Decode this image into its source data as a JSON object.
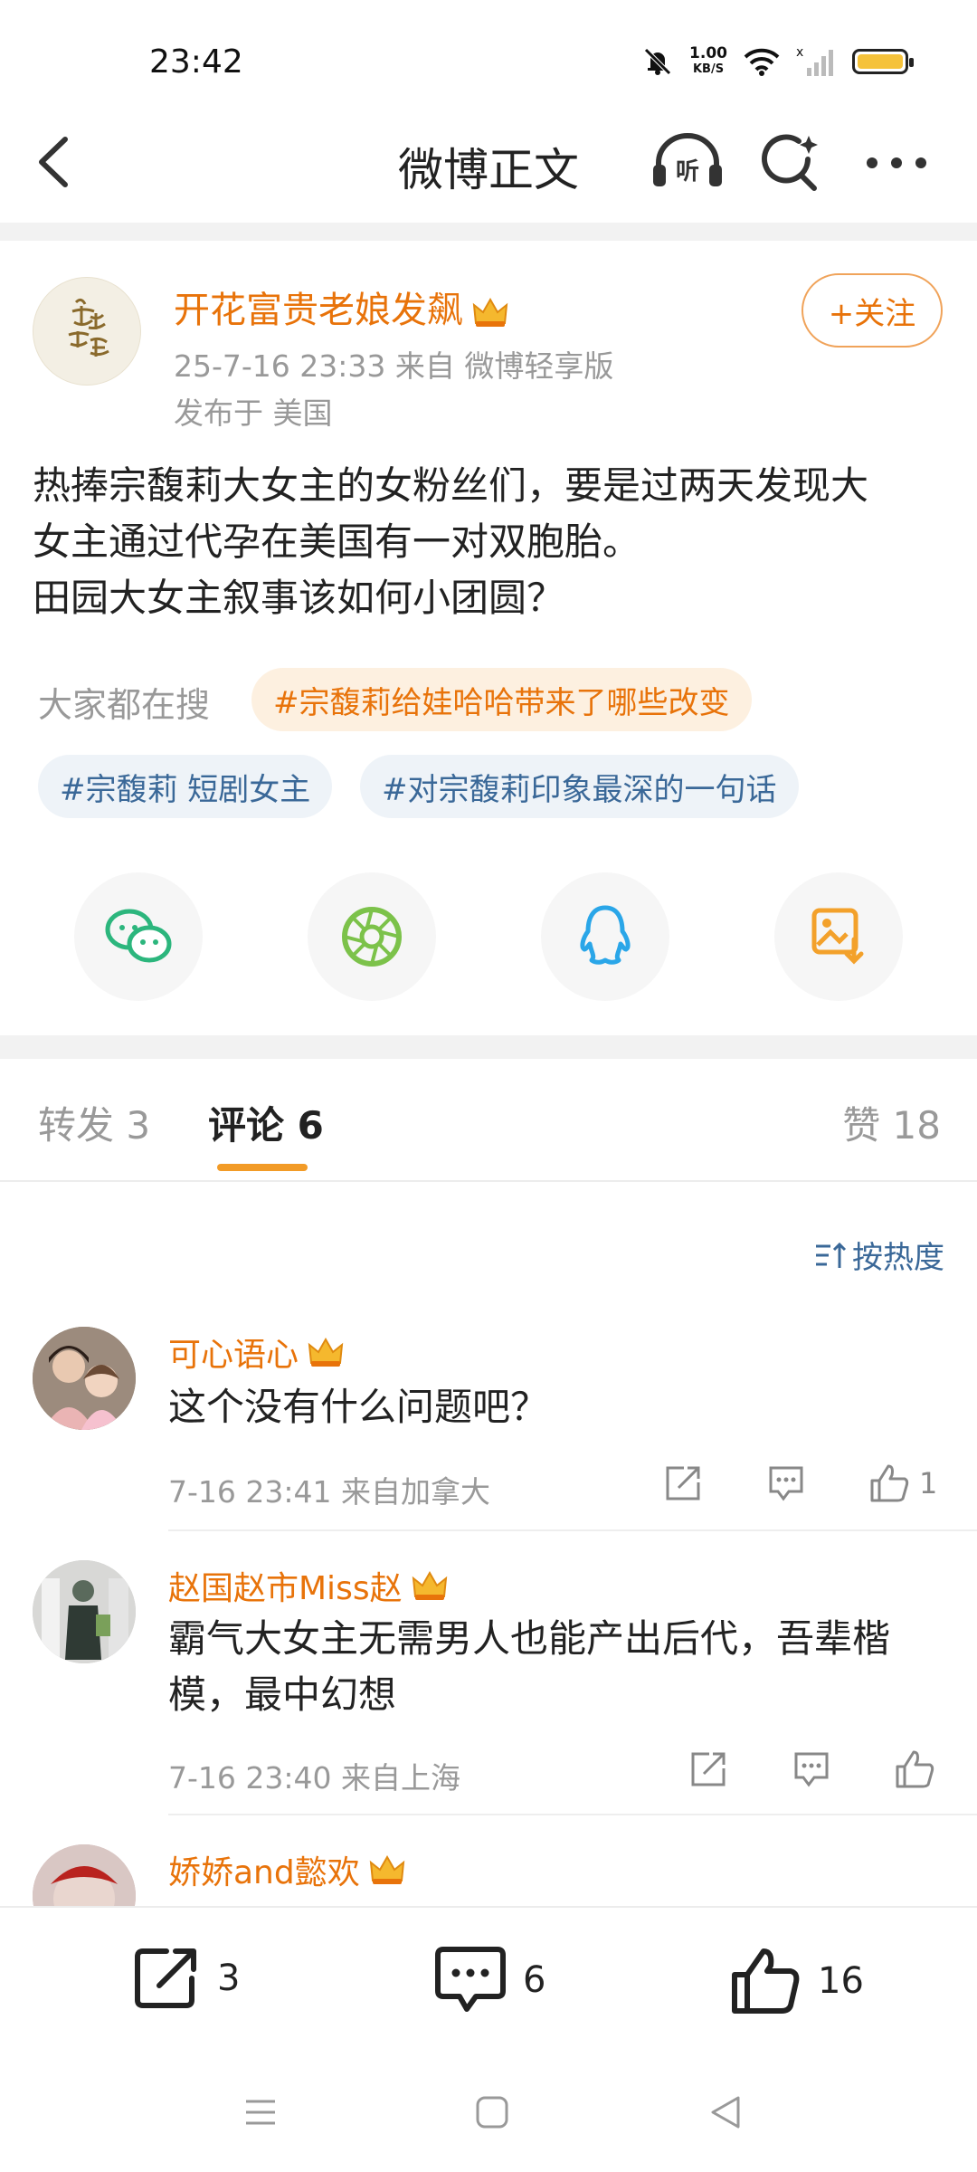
{
  "status_bar": {
    "time": "23:42",
    "net_speed_top": "1.00",
    "net_speed_bottom": "KB/S"
  },
  "nav": {
    "title": "微博正文",
    "listen_label": "听"
  },
  "post": {
    "username": "开花富贵老娘发飙",
    "time_source": "25-7-16 23:33   来自 微博轻享版",
    "location": "发布于 美国",
    "follow_label": "+关注",
    "lines": [
      "热捧宗馥莉大女主的女粉丝们，要是过两天发现大",
      "女主通过代孕在美国有一对双胞胎。",
      "田园大女主叙事该如何小团圆？"
    ]
  },
  "searches": {
    "label": "大家都在搜",
    "hot_tag": "#宗馥莉给娃哈哈带来了哪些改变",
    "tags": [
      "#宗馥莉 短剧女主",
      "#对宗馥莉印象最深的一句话"
    ]
  },
  "share": {
    "icons": [
      "wechat-icon",
      "moments-icon",
      "qq-icon",
      "save-image-icon"
    ]
  },
  "tabs": {
    "repost": "转发 3",
    "comments": "评论 6",
    "likes": "赞 18"
  },
  "sort_label": "按热度",
  "comments": [
    {
      "name": "可心语心",
      "text": [
        "这个没有什么问题吧？"
      ],
      "meta": "7-16 23:41  来自加拿大",
      "likes": "1"
    },
    {
      "name": "赵国赵市Miss赵",
      "text": [
        "霸气大女主无需男人也能产出后代，吾辈楷",
        "模，最中幻想"
      ],
      "meta": "7-16 23:40  来自上海",
      "likes": ""
    },
    {
      "name": "娇娇and懿欢"
    }
  ],
  "bottom_bar": {
    "repost_count": "3",
    "comment_count": "6",
    "like_count": "16"
  },
  "colors": {
    "accent": "#e8730a",
    "tag_blue": "#3a6898",
    "tab_underline": "#f29b27"
  }
}
